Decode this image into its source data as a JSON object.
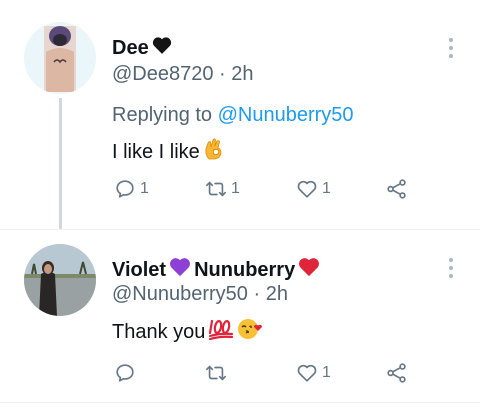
{
  "tweets": [
    {
      "display_name": "Dee",
      "name_emoji": "black-heart-icon",
      "handle": "@Dee8720",
      "time": "2h",
      "replying_label": "Replying to",
      "replying_to": "@Nunuberry50",
      "text": "I like I like",
      "text_emoji": "ok-hand-icon",
      "reply_count": "1",
      "retweet_count": "1",
      "like_count": "1"
    },
    {
      "display_name_1": "Violet",
      "display_name_2": "Nunuberry",
      "handle": "@Nunuberry50",
      "time": "2h",
      "text": "Thank you",
      "text_emojis": [
        "hundred-points-icon",
        "face-blowing-kiss-icon"
      ],
      "like_count": "1"
    }
  ],
  "colors": {
    "mention": "#1d9bf0",
    "secondary_text": "#536471",
    "icon": "#657786",
    "thread_line": "#cfd9de",
    "purple_heart": "#8e3fd6",
    "red_heart": "#e0243a"
  }
}
